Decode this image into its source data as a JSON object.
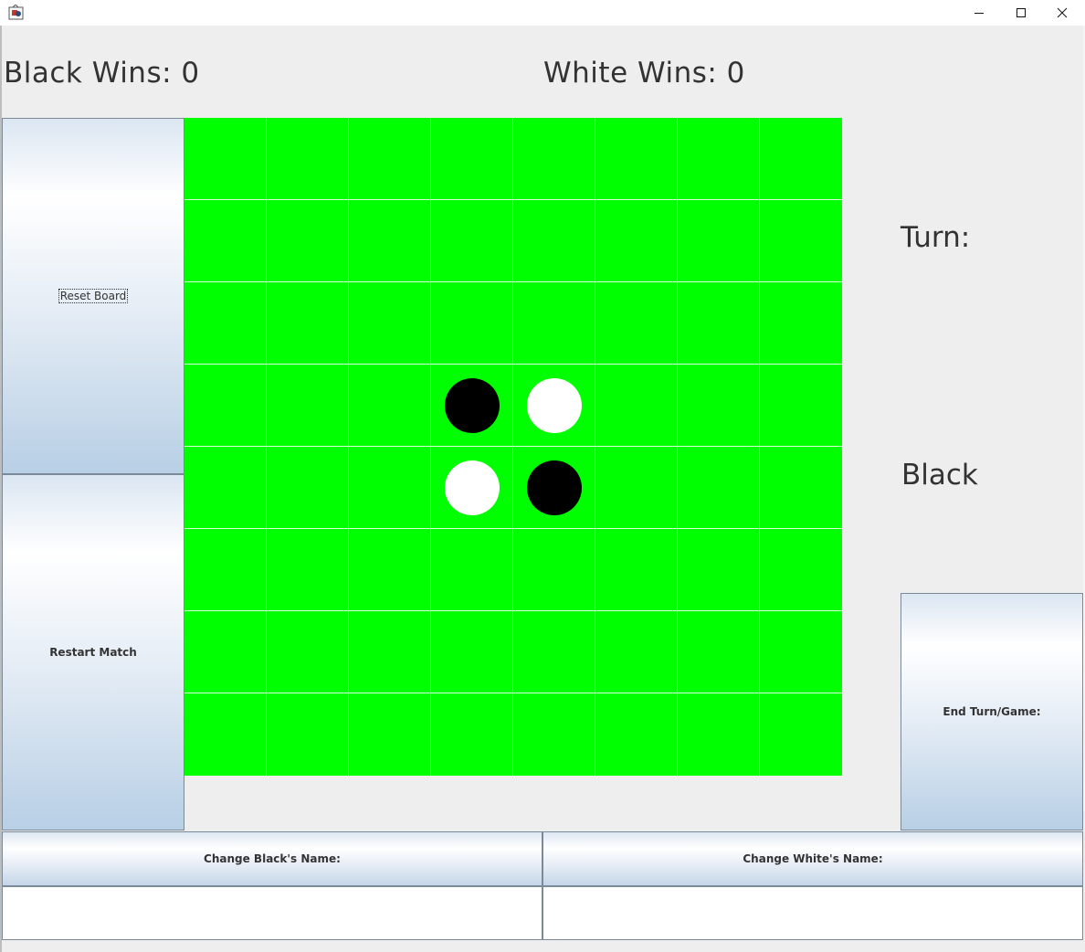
{
  "window": {
    "icon": "java-app-icon",
    "controls": [
      "minimize-icon",
      "maximize-icon",
      "close-icon"
    ]
  },
  "scores": {
    "black_text": "Black Wins: 0",
    "white_text": "White Wins: 0",
    "black_wins": 0,
    "white_wins": 0
  },
  "buttons": {
    "reset_board": "Reset Board",
    "restart_match": "Restart Match",
    "end_turn": "End Turn/Game:",
    "change_black_name": "Change Black's Name:",
    "change_white_name": "Change White's Name:"
  },
  "turn": {
    "label": "Turn:",
    "current": "Black"
  },
  "inputs": {
    "black_name_value": "",
    "white_name_value": ""
  },
  "board": {
    "rows": 8,
    "cols": 8,
    "board_color": "#00ff00",
    "grid_line_color": "#d9ffd9",
    "pieces": [
      {
        "row": 3,
        "col": 3,
        "color": "black"
      },
      {
        "row": 3,
        "col": 4,
        "color": "white"
      },
      {
        "row": 4,
        "col": 3,
        "color": "white"
      },
      {
        "row": 4,
        "col": 4,
        "color": "black"
      }
    ]
  }
}
